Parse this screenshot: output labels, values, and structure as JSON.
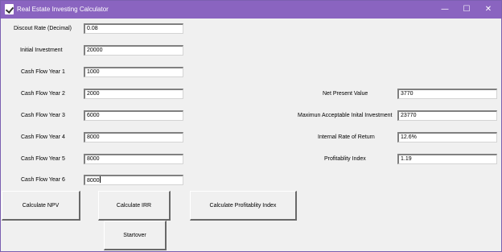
{
  "window": {
    "title": "Real Estate Investing Calculator"
  },
  "window_controls": {
    "minimize": "—",
    "maximize": "☐",
    "close": "✕"
  },
  "inputs": [
    {
      "label": "Discout Rate (Decimal)",
      "value": "0.08"
    },
    {
      "label": "Initial Investment",
      "value": "20000"
    },
    {
      "label": "Cash Flow Year 1",
      "value": "1000"
    },
    {
      "label": "Cash Flow Year 2",
      "value": "2000"
    },
    {
      "label": "Cash Flow Year 3",
      "value": "6000"
    },
    {
      "label": "Cash Flow Year 4",
      "value": "8000"
    },
    {
      "label": "Cash Flow Year 5",
      "value": "8000"
    },
    {
      "label": "Cash Flow Year 6",
      "value": "8000"
    }
  ],
  "outputs": [
    {
      "label": "Net Present Value",
      "value": "3770"
    },
    {
      "label": "Maximun Acceptable Inital Investment",
      "value": "23770"
    },
    {
      "label": "Internal Rate of Return",
      "value": "12.6%"
    },
    {
      "label": "Profitablity Index",
      "value": "1.19"
    }
  ],
  "buttons": {
    "npv": "Calculate NPV",
    "irr": "Calculate IRR",
    "pi": "Calculate Profitablity Index",
    "startover": "Startover"
  }
}
